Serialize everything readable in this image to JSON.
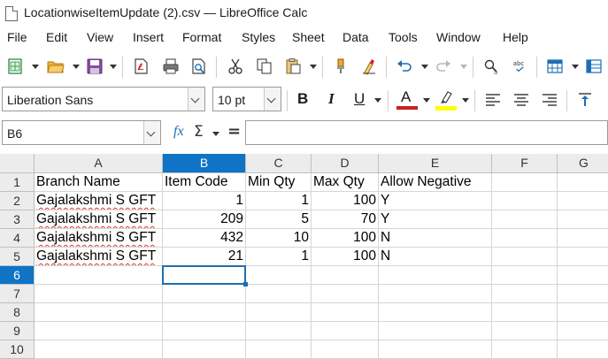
{
  "window": {
    "title": "LocationwiseItemUpdate (2).csv — LibreOffice Calc"
  },
  "menu": [
    "File",
    "Edit",
    "View",
    "Insert",
    "Format",
    "Styles",
    "Sheet",
    "Data",
    "Tools",
    "Window",
    "Help"
  ],
  "toolbar": {
    "icons": [
      "new-spreadsheet-icon",
      "open-folder-icon",
      "save-icon",
      "export-pdf-icon",
      "print-icon",
      "print-preview-icon",
      "cut-icon",
      "copy-icon",
      "paste-icon",
      "clone-formatting-icon",
      "clear-formatting-icon",
      "undo-icon",
      "redo-icon",
      "find-replace-icon",
      "spelling-icon",
      "row-icon",
      "column-icon"
    ],
    "spelling_label": "abc"
  },
  "format": {
    "font_name": "Liberation Sans",
    "font_size": "10 pt",
    "bold": "B",
    "italic": "I",
    "underline": "U",
    "font_color_glyph": "A",
    "font_color": "#c9211e",
    "highlight_color": "#ffff00"
  },
  "formula": {
    "name_box": "B6",
    "fx": "fx",
    "sigma": "Σ",
    "equals": "=",
    "content": ""
  },
  "sheet": {
    "columns": [
      "A",
      "B",
      "C",
      "D",
      "E",
      "F",
      "G"
    ],
    "active_column": "B",
    "rows": [
      "1",
      "2",
      "3",
      "4",
      "5",
      "6",
      "7",
      "8",
      "9",
      "10"
    ],
    "active_row": "6",
    "data": [
      [
        "Branch Name",
        "Item Code",
        "Min Qty",
        "Max Qty",
        "Allow Negative"
      ],
      [
        "Gajalakshmi S GFT",
        "1",
        "1",
        "100",
        "Y"
      ],
      [
        "Gajalakshmi S GFT",
        "209",
        "5",
        "70",
        "Y"
      ],
      [
        "Gajalakshmi S GFT",
        "432",
        "10",
        "100",
        "N"
      ],
      [
        "Gajalakshmi S GFT",
        "21",
        "1",
        "100",
        "N"
      ]
    ],
    "selected_cell": "B6"
  },
  "colors": {
    "accent": "#0f73c6",
    "header_bg": "#ececec"
  }
}
